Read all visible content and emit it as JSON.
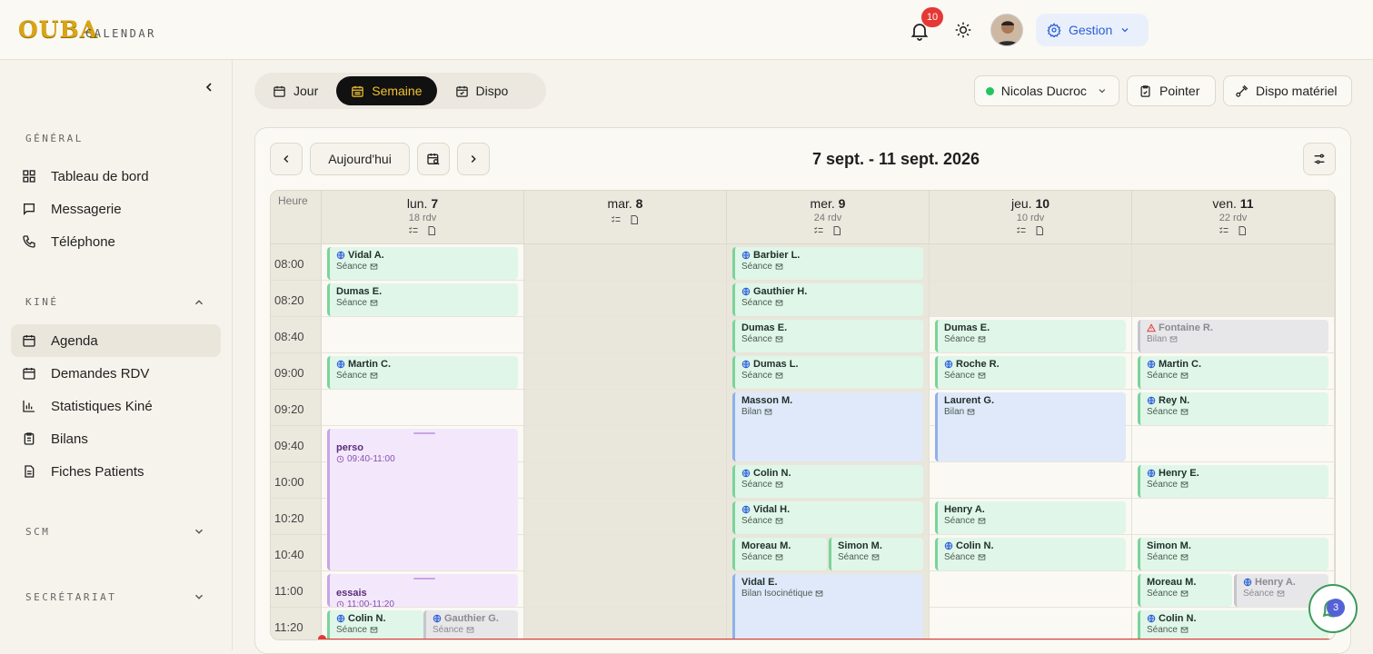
{
  "brand": {
    "logo": "OUBA",
    "subtitle": "CALENDAR"
  },
  "header": {
    "notifications_count": "10",
    "gestion_label": "Gestion"
  },
  "sidebar": {
    "general_title": "GÉNÉRAL",
    "general_items": [
      "Tableau de bord",
      "Messagerie",
      "Téléphone"
    ],
    "kine_title": "KINÉ",
    "kine_items": [
      "Agenda",
      "Demandes RDV",
      "Statistiques Kiné",
      "Bilans",
      "Fiches Patients"
    ],
    "scm_title": "SCM",
    "secretariat_title": "SECRÉTARIAT"
  },
  "views": {
    "day": "Jour",
    "week": "Semaine",
    "dispo": "Dispo",
    "active": "week"
  },
  "toolbar": {
    "practitioner": "Nicolas Ducroc",
    "pointer": "Pointer",
    "dispo_materiel": "Dispo matériel"
  },
  "nav": {
    "today": "Aujourd'hui",
    "range": "7 sept. - 11 sept. 2026"
  },
  "calendar": {
    "hour_label": "Heure",
    "times": [
      "08:00",
      "08:20",
      "08:40",
      "09:00",
      "09:20",
      "09:40",
      "10:00",
      "10:20",
      "10:40",
      "11:00",
      "11:20"
    ],
    "days": [
      {
        "label": "lun.",
        "num": "7",
        "count": "18 rdv"
      },
      {
        "label": "mar.",
        "num": "8",
        "count": ""
      },
      {
        "label": "mer.",
        "num": "9",
        "count": "24 rdv"
      },
      {
        "label": "jeu.",
        "num": "10",
        "count": "10 rdv"
      },
      {
        "label": "ven.",
        "num": "11",
        "count": "22 rdv"
      }
    ],
    "events": [
      {
        "name": "Vidal A.",
        "type": "Séance",
        "globe": true
      },
      {
        "name": "Dumas E.",
        "type": "Séance"
      },
      {
        "name": "Martin C.",
        "type": "Séance",
        "globe": true
      },
      {
        "name": "perso",
        "time": "09:40-11:00"
      },
      {
        "name": "essais",
        "time": "11:00-11:20"
      },
      {
        "name": "Colin N.",
        "type": "Séance",
        "globe": true
      },
      {
        "name": "Gauthier G.",
        "type": "Séance",
        "globe": true
      },
      {
        "name": "Barbier L.",
        "type": "Séance",
        "globe": true
      },
      {
        "name": "Gauthier H.",
        "type": "Séance",
        "globe": true
      },
      {
        "name": "Dumas E.",
        "type": "Séance"
      },
      {
        "name": "Dumas L.",
        "type": "Séance",
        "globe": true
      },
      {
        "name": "Masson M.",
        "type": "Bilan"
      },
      {
        "name": "Colin N.",
        "type": "Séance",
        "globe": true
      },
      {
        "name": "Vidal H.",
        "type": "Séance",
        "globe": true
      },
      {
        "name": "Moreau M.",
        "type": "Séance"
      },
      {
        "name": "Simon M.",
        "type": "Séance"
      },
      {
        "name": "Vidal E.",
        "type": "Bilan Isocinétique"
      },
      {
        "name": "Dumas E.",
        "type": "Séance"
      },
      {
        "name": "Roche R.",
        "type": "Séance",
        "globe": true
      },
      {
        "name": "Laurent G.",
        "type": "Bilan"
      },
      {
        "name": "Henry A.",
        "type": "Séance"
      },
      {
        "name": "Colin N.",
        "type": "Séance",
        "globe": true
      },
      {
        "name": "Fontaine R.",
        "type": "Bilan",
        "warn": true
      },
      {
        "name": "Martin C.",
        "type": "Séance",
        "globe": true
      },
      {
        "name": "Rey N.",
        "type": "Séance",
        "globe": true
      },
      {
        "name": "Henry E.",
        "type": "Séance",
        "globe": true
      },
      {
        "name": "Simon M.",
        "type": "Séance"
      },
      {
        "name": "Moreau M.",
        "type": "Séance"
      },
      {
        "name": "Henry A.",
        "type": "Séance",
        "globe": true
      },
      {
        "name": "Colin N.",
        "type": "Séance",
        "globe": true
      }
    ]
  },
  "fab": {
    "count": "3"
  },
  "colors": {
    "accent": "#f1c232",
    "event_green": "#e0f6e8",
    "event_blue": "#dfe9fa",
    "event_purple": "#f3e8fb",
    "now_line": "#e53935"
  }
}
